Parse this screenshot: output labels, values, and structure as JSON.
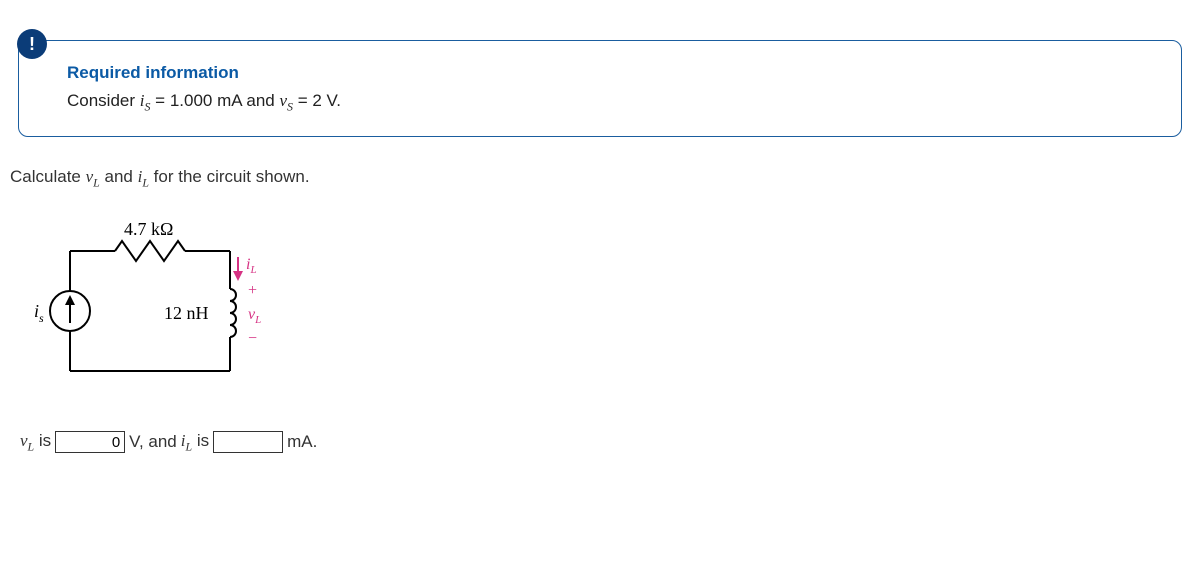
{
  "info": {
    "badge": "!",
    "title": "Required information",
    "consider_pre": "Consider ",
    "is_var": "i",
    "is_sub": "S",
    "is_eq": " = 1.000 mA and ",
    "vs_var": "v",
    "vs_sub": "S",
    "vs_eq": " = 2 V."
  },
  "prompt": {
    "pre": "Calculate ",
    "vL_var": "v",
    "vL_sub": "L",
    "and": " and ",
    "iL_var": "i",
    "iL_sub": "L",
    "post": " for the circuit shown."
  },
  "circuit": {
    "R_label": "4.7 kΩ",
    "L_label": "12 nH",
    "is_label": "i",
    "is_sub": "s",
    "iL_label": "i",
    "iL_sub": "L",
    "vL_label": "v",
    "vL_sub": "L",
    "plus": "+",
    "minus": "−"
  },
  "answers": {
    "vL_var": "v",
    "vL_sub": "L",
    "vL_is": " is ",
    "vL_value": "0",
    "v_unit_and": " V, and ",
    "iL_var": "i",
    "iL_sub": "L",
    "iL_is": " is ",
    "iL_value": "",
    "iL_unit": " mA."
  }
}
